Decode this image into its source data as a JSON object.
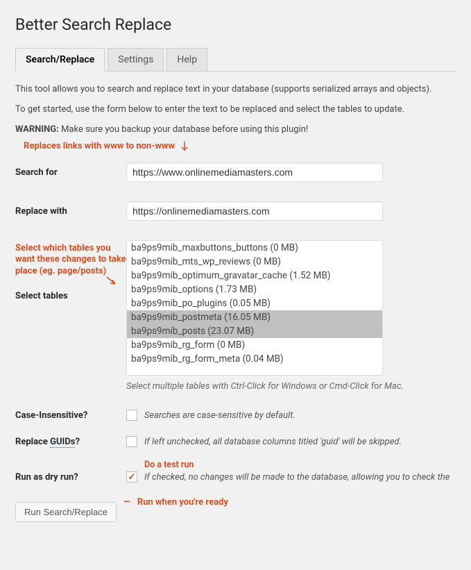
{
  "page_title": "Better Search Replace",
  "tabs": {
    "search_replace": "Search/Replace",
    "settings": "Settings",
    "help": "Help"
  },
  "intro": {
    "line1": "This tool allows you to search and replace text in your database (supports serialized arrays and objects).",
    "line2": "To get started, use the form below to enter the text to be replaced and select the tables to update.",
    "warn_label": "WARNING:",
    "warn_text": " Make sure you backup your database before using this plugin!"
  },
  "annotations": {
    "top": "Replaces links with www to non-www",
    "tables_side": "Select which tables you want these changes to take place (eg. page/posts)",
    "dry_run": "Do a test run",
    "run": "Run when you're ready"
  },
  "form": {
    "search_for_label": "Search for",
    "search_for_value": "https://www.onlinemediamasters.com",
    "replace_with_label": "Replace with",
    "replace_with_value": "https://onlinemediamasters.com",
    "select_tables_label": "Select tables",
    "tables": [
      {
        "name": "ba9ps9mib_maxbuttons_buttons (0 MB)",
        "selected": false
      },
      {
        "name": "ba9ps9mib_mts_wp_reviews (0 MB)",
        "selected": false
      },
      {
        "name": "ba9ps9mib_optimum_gravatar_cache (1.52 MB)",
        "selected": false
      },
      {
        "name": "ba9ps9mib_options (1.73 MB)",
        "selected": false
      },
      {
        "name": "ba9ps9mib_po_plugins (0.05 MB)",
        "selected": false
      },
      {
        "name": "ba9ps9mib_postmeta (16.05 MB)",
        "selected": true
      },
      {
        "name": "ba9ps9mib_posts (23.07 MB)",
        "selected": true
      },
      {
        "name": "ba9ps9mib_rg_form (0 MB)",
        "selected": false
      },
      {
        "name": "ba9ps9mib_rg_form_meta (0.04 MB)",
        "selected": false
      }
    ],
    "tables_help": "Select multiple tables with Ctrl-Click for Windows or Cmd-Click for Mac.",
    "case_label": "Case-Insensitive?",
    "case_help": "Searches are case-sensitive by default.",
    "guid_label_a": "Replace ",
    "guid_label_b": "GUIDs",
    "guid_label_c": "?",
    "guid_help": "If left unchecked, all database columns titled 'guid' will be skipped.",
    "dry_label": "Run as dry run?",
    "dry_help": "If checked, no changes will be made to the database, allowing you to check the ",
    "submit": "Run Search/Replace"
  }
}
